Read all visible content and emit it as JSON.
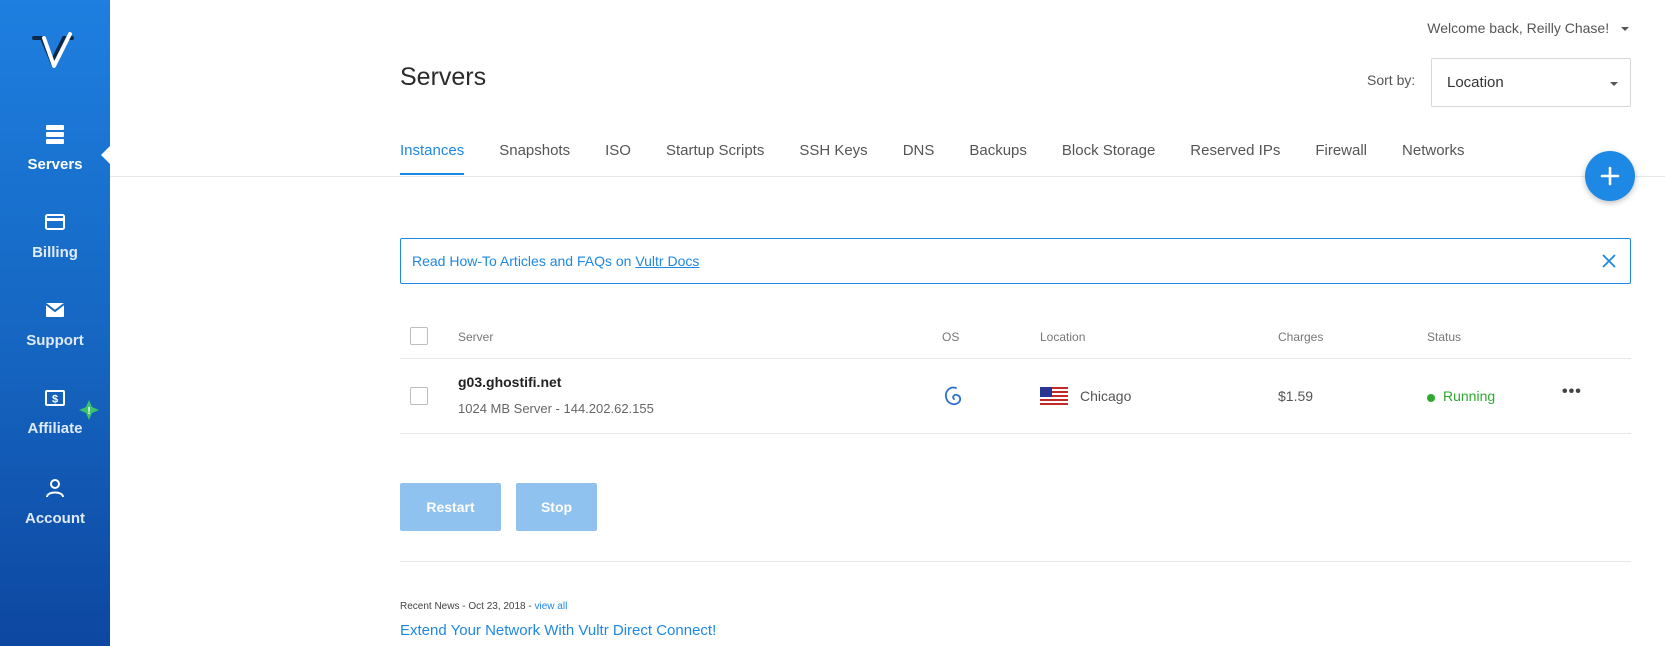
{
  "sidebar": {
    "logo_icon": "vultr-logo",
    "items": [
      {
        "label": "Servers",
        "icon": "servers-icon",
        "active": true
      },
      {
        "label": "Billing",
        "icon": "credit-card-icon",
        "active": false
      },
      {
        "label": "Support",
        "icon": "envelope-icon",
        "active": false
      },
      {
        "label": "Affiliate",
        "icon": "dollar-icon",
        "active": false,
        "badge": "!"
      },
      {
        "label": "Account",
        "icon": "user-icon",
        "active": false
      }
    ]
  },
  "header": {
    "welcome": "Welcome back, Reilly Chase!",
    "title": "Servers",
    "sort_label": "Sort by:",
    "sort_value": "Location"
  },
  "tabs": [
    {
      "label": "Instances",
      "active": true
    },
    {
      "label": "Snapshots"
    },
    {
      "label": "ISO"
    },
    {
      "label": "Startup Scripts"
    },
    {
      "label": "SSH Keys"
    },
    {
      "label": "DNS"
    },
    {
      "label": "Backups"
    },
    {
      "label": "Block Storage"
    },
    {
      "label": "Reserved IPs"
    },
    {
      "label": "Firewall"
    },
    {
      "label": "Networks"
    }
  ],
  "alert": {
    "text": "Read How-To Articles and FAQs on ",
    "link": "Vultr Docs"
  },
  "table": {
    "headers": {
      "server": "Server",
      "os": "OS",
      "location": "Location",
      "charges": "Charges",
      "status": "Status"
    },
    "rows": [
      {
        "name": "g03.ghostifi.net",
        "details": "1024 MB Server - 144.202.62.155",
        "os_icon": "debian-icon",
        "flag_icon": "us-flag-icon",
        "location": "Chicago",
        "charges": "$1.59",
        "status": "Running",
        "more": "•••"
      }
    ]
  },
  "actions": {
    "restart": "Restart",
    "stop": "Stop"
  },
  "news": {
    "meta": "Recent News - Oct 23, 2018 - ",
    "view_all": "view all",
    "headline": "Extend Your Network With Vultr Direct Connect!"
  },
  "colors": {
    "accent": "#1e88e5",
    "sidebar": "#1565c0",
    "running": "#2eaa2e",
    "disabled_button": "#90c2ef"
  }
}
